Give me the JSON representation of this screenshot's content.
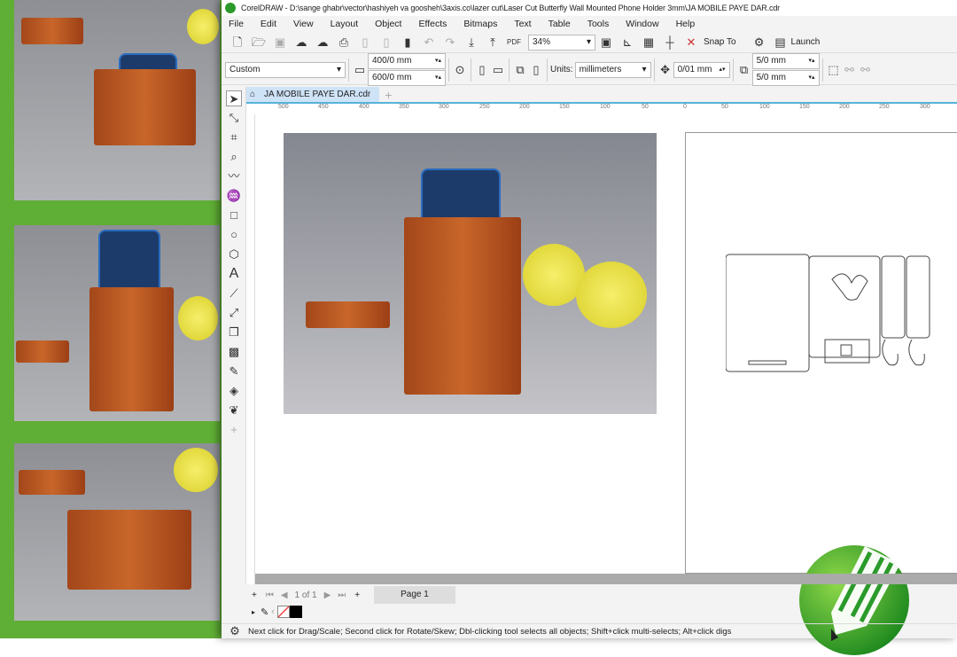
{
  "window": {
    "title": "CorelDRAW - D:\\sange ghabr\\vector\\hashiyeh va goosheh\\3axis.co\\lazer cut\\Laser Cut Butterfly Wall Mounted Phone Holder 3mm\\JA MOBILE PAYE DAR.cdr"
  },
  "menu": [
    "File",
    "Edit",
    "View",
    "Layout",
    "Object",
    "Effects",
    "Bitmaps",
    "Text",
    "Table",
    "Tools",
    "Window",
    "Help"
  ],
  "toolbar": {
    "zoom": "34%",
    "snap_to": "Snap To",
    "launch": "Launch"
  },
  "propbar": {
    "page_preset": "Custom",
    "width": "400/0 mm",
    "height": "600/0 mm",
    "units_label": "Units:",
    "units": "millimeters",
    "nudge": "0/01 mm",
    "dup_x": "5/0 mm",
    "dup_y": "5/0 mm"
  },
  "document_tab": "JA MOBILE PAYE DAR.cdr",
  "ruler_ticks": [
    "500",
    "450",
    "400",
    "350",
    "300",
    "250",
    "200",
    "150",
    "100",
    "50",
    "0",
    "50",
    "100",
    "150",
    "200",
    "250",
    "300"
  ],
  "pages": {
    "counter": "1 of 1",
    "tab": "Page 1"
  },
  "status": "Next click for Drag/Scale; Second click for Rotate/Skew; Dbl-clicking tool selects all objects; Shift+click multi-selects; Alt+click digs",
  "colors": {
    "accent_green": "#5fae35",
    "ruler_blue": "#57b3da",
    "tab_blue": "#cfe3f7"
  }
}
